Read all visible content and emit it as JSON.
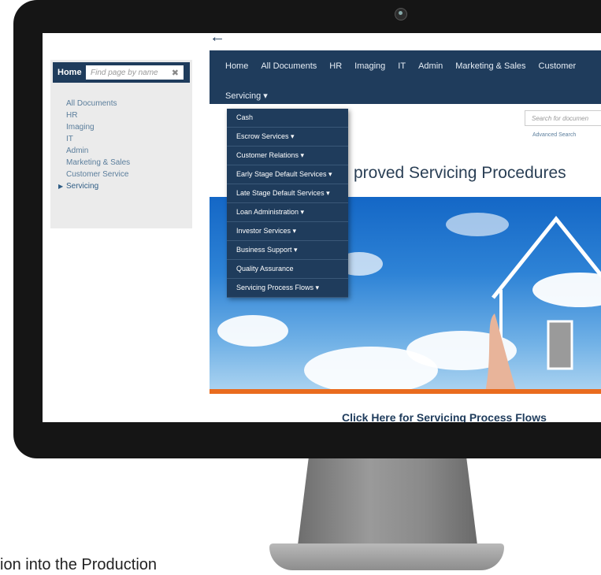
{
  "sidebar": {
    "home_label": "Home",
    "search_placeholder": "Find page by name",
    "clear_glyph": "✖",
    "items": [
      {
        "label": "All Documents"
      },
      {
        "label": "HR"
      },
      {
        "label": "Imaging"
      },
      {
        "label": "IT"
      },
      {
        "label": "Admin"
      },
      {
        "label": "Marketing & Sales"
      },
      {
        "label": "Customer Service"
      },
      {
        "label": "Servicing",
        "active": true
      }
    ]
  },
  "nav": {
    "back_glyph": "←",
    "items": [
      "Home",
      "All Documents",
      "HR",
      "Imaging",
      "IT",
      "Admin",
      "Marketing & Sales",
      "Customer"
    ],
    "servicing_label": "Servicing ▾"
  },
  "dropdown": {
    "items": [
      "Cash",
      "Escrow Services ▾",
      "Customer Relations ▾",
      "Early Stage Default Services ▾",
      "Late Stage Default Services ▾",
      "Loan Administration ▾",
      "Investor Services ▾",
      "Business Support ▾",
      "Quality Assurance",
      "Servicing Process Flows ▾"
    ]
  },
  "search": {
    "placeholder": "Search for documen",
    "advanced_label": "Advanced Search"
  },
  "page": {
    "heading": "proved Servicing Procedures",
    "bottom_link": "Click Here for Servicing Process Flows"
  },
  "caption": "ion into the Production",
  "colors": {
    "navy": "#1f3c5c",
    "accent_orange": "#e96b1e",
    "sky_blue": "#2e83d6"
  }
}
